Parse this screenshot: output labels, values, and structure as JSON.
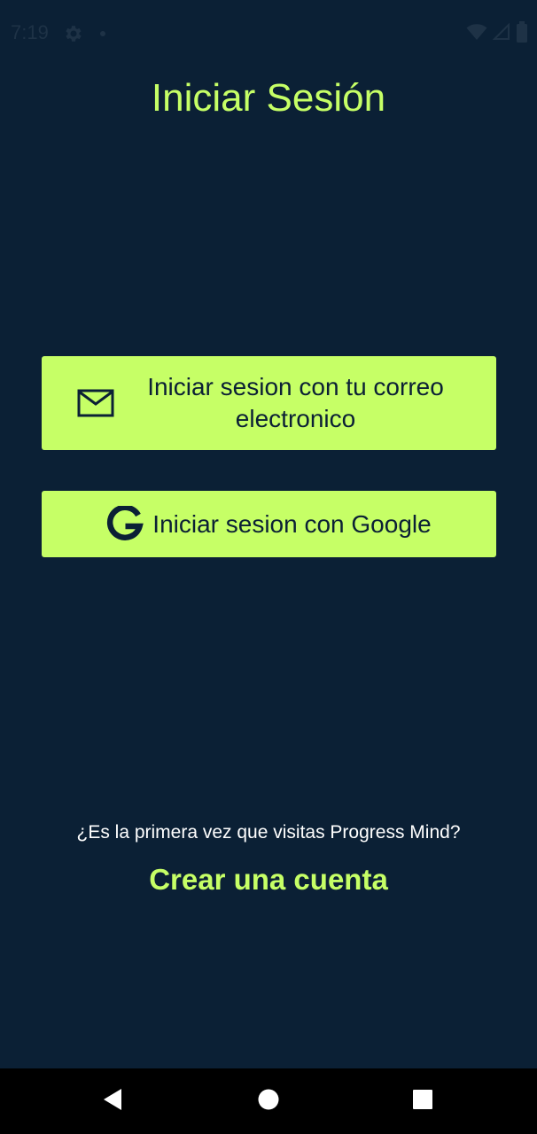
{
  "status_bar": {
    "time": "7:19",
    "icons": [
      "gear-icon",
      "notification-dot-icon",
      "wifi-icon",
      "signal-icon",
      "battery-icon"
    ]
  },
  "page": {
    "title": "Iniciar Sesión"
  },
  "buttons": {
    "email_label": "Iniciar sesion con tu correo electronico",
    "email_icon": "mail-icon",
    "google_label": "Iniciar sesion con Google",
    "google_icon": "google-icon"
  },
  "footer": {
    "first_visit_text": "¿Es la primera vez que visitas Progress Mind?",
    "create_account_label": "Crear una cuenta"
  },
  "nav_bar": {
    "icons": [
      "back-icon",
      "home-icon",
      "recents-icon"
    ]
  },
  "colors": {
    "background": "#0b2035",
    "accent": "#c6ff66",
    "button_text": "#0b2035",
    "nav_background": "#000000"
  }
}
